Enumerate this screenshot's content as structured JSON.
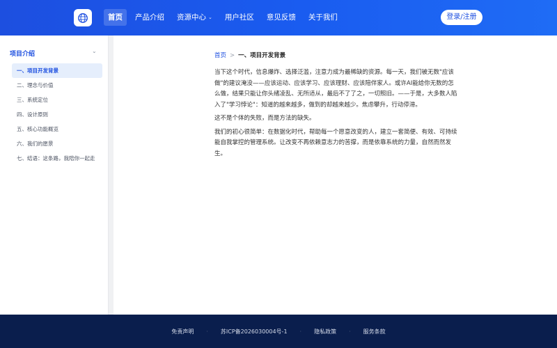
{
  "header": {
    "logo_icon": "globe-logo-icon",
    "nav": [
      {
        "label": "首页",
        "active": true,
        "dropdown": false
      },
      {
        "label": "产品介绍",
        "active": false,
        "dropdown": false
      },
      {
        "label": "资源中心",
        "active": false,
        "dropdown": true
      },
      {
        "label": "用户社区",
        "active": false,
        "dropdown": false
      },
      {
        "label": "意见反馈",
        "active": false,
        "dropdown": false
      },
      {
        "label": "关于我们",
        "active": false,
        "dropdown": false
      }
    ],
    "login_label": "登录/注册"
  },
  "sidebar": {
    "title": "项目介绍",
    "caret": "chevron-down-icon",
    "items": [
      {
        "label": "一、项目开发背景",
        "active": true
      },
      {
        "label": "二、理念与价值",
        "active": false
      },
      {
        "label": "三、系统定位",
        "active": false
      },
      {
        "label": "四、设计原则",
        "active": false
      },
      {
        "label": "五、核心功能概览",
        "active": false
      },
      {
        "label": "六、我们的愿景",
        "active": false
      },
      {
        "label": "七、结语：这条路，我陪你一起走",
        "active": false
      }
    ]
  },
  "breadcrumb": {
    "home": "首页",
    "separator": ">",
    "current": "一、项目开发背景"
  },
  "article": {
    "paragraphs": [
      "当下这个时代，信息爆炸、选择泛滥，注意力成为最稀缺的资源。每一天，我们被无数\"应该做\"的建议淹没——应该运动、应该学习、应该理财、应该陪伴家人。或许AI能给你无数的怎么做，结果只能让你头绪凌乱、无所适从，最后不了了之，一切照旧。——于是，大多数人陷入了\"学习悖论\"：知道的越来越多，做到的却越来越少。焦虑攀升，行动停滞。",
      "这不是个体的失败，而是方法的缺失。",
      "我们的初心很简单：在数据化时代，帮助每一个愿意改变的人，建立一套简便、有效、可持续能自我掌控的管理系统。让改变不再依赖意志力的苦撑，而是依靠系统的力量，自然而然发生。"
    ]
  },
  "footer": {
    "links": [
      "免责声明",
      "苏ICP备2026030004号-1",
      "隐私政策",
      "服务条款"
    ],
    "separator": "·"
  },
  "colors": {
    "primary": "#1d4fe0",
    "footer_bg": "#0a1e4d",
    "active_item_bg": "#e5eefc"
  }
}
